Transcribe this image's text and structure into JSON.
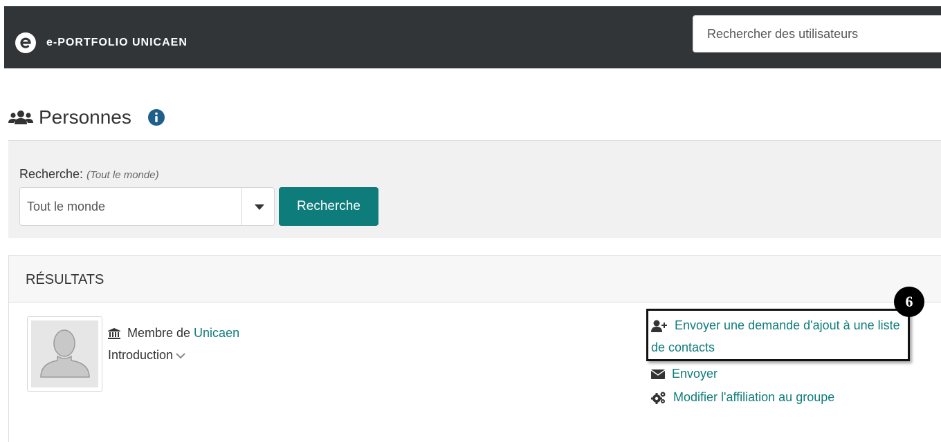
{
  "header": {
    "brand": "e-PORTFOLIO UNICAEN",
    "search_placeholder": "Rechercher des utilisateurs"
  },
  "page": {
    "title": "Personnes"
  },
  "search": {
    "label": "Recherche:",
    "label_hint": "(Tout le monde)",
    "select_value": "Tout le monde",
    "button_label": "Recherche"
  },
  "results": {
    "header": "RÉSULTATS",
    "items": [
      {
        "member_prefix": "Membre de",
        "member_link": "Unicaen",
        "intro_label": "Introduction",
        "actions": {
          "add_contact": "Envoyer une demande d'ajout à une liste de contacts",
          "send": "Envoyer",
          "group": "Modifier l'affiliation au groupe"
        }
      }
    ]
  },
  "annotation": {
    "step_number": "6"
  },
  "colors": {
    "topbar": "#323538",
    "accent": "#0e7c7b",
    "panel": "#f1f1f1"
  }
}
